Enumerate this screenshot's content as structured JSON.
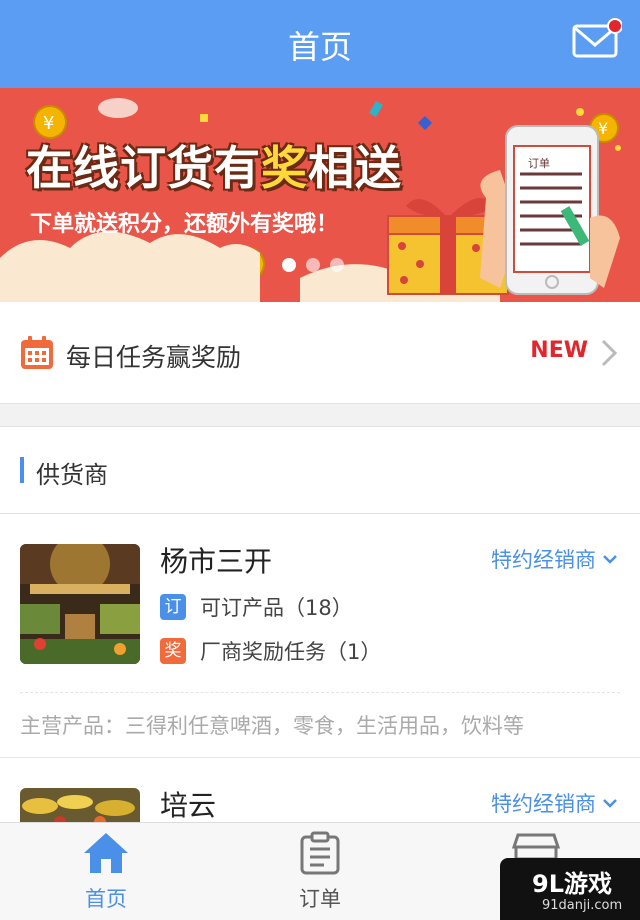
{
  "header": {
    "title": "首页"
  },
  "banner": {
    "headline_pre": "在线订货有",
    "headline_highlight": "奖",
    "headline_post": "相送",
    "subtitle": "下单就送积分，还额外有奖哦！",
    "phone_screen_title": "订单",
    "carousel": {
      "count": 3,
      "active_index": 0
    }
  },
  "task": {
    "label": "每日任务赢奖励",
    "badge": "NEW"
  },
  "suppliers": {
    "section_title": "供货商",
    "items": [
      {
        "name": "杨市三开",
        "tag": "特约经销商",
        "order_badge": "订",
        "order_text": "可订产品（18）",
        "reward_badge": "奖",
        "reward_text": "厂商奖励任务（1）",
        "description": "主营产品：三得利任意啤酒，零食，生活用品，饮料等"
      },
      {
        "name": "培云",
        "tag": "特约经销商"
      }
    ]
  },
  "tabbar": {
    "items": [
      {
        "label": "首页",
        "active": true
      },
      {
        "label": "订单",
        "active": false
      },
      {
        "label": "",
        "active": false
      }
    ]
  },
  "watermark": {
    "logo": "9L游戏",
    "url": "91danji.com"
  },
  "colors": {
    "header_bg": "#5b9df2",
    "accent_blue": "#4a90e8",
    "banner_red": "#e95649",
    "new_red": "#e3262b",
    "order_badge": "#4a90e8",
    "reward_badge": "#f06a3c"
  }
}
